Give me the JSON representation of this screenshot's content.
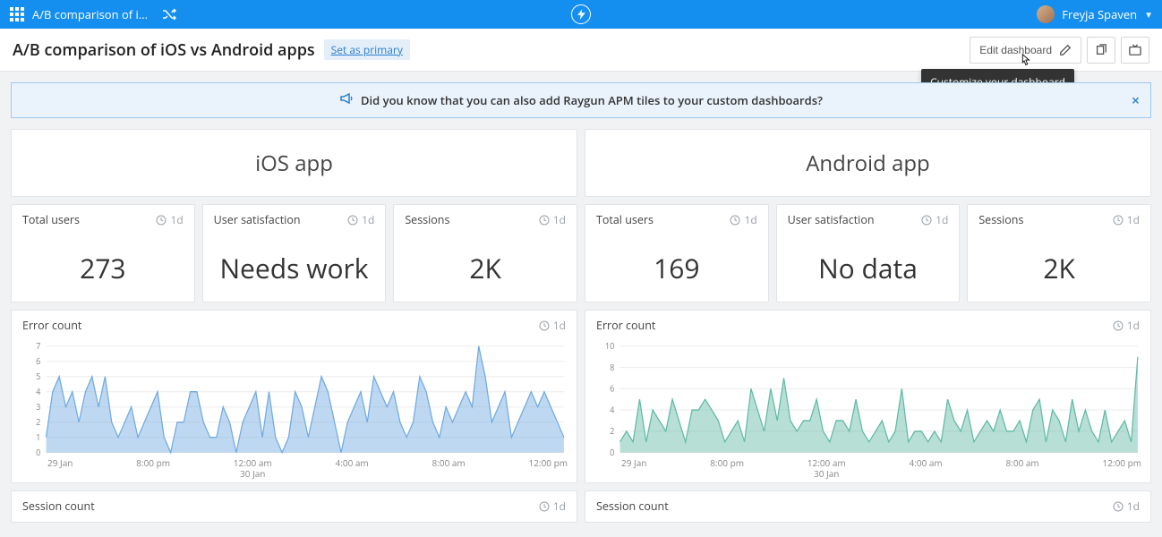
{
  "topbar": {
    "title_truncated": "A/B comparison of i…",
    "user_name": "Freyja Spaven"
  },
  "titlebar": {
    "title": "A/B comparison of iOS vs Android apps",
    "set_primary": "Set as primary",
    "edit_dashboard": "Edit dashboard",
    "tooltip": "Customize your dashboard"
  },
  "banner": {
    "text": "Did you know that you can also add Raygun APM tiles to your custom dashboards?"
  },
  "period_label": "1d",
  "ios": {
    "heading": "iOS app",
    "stats": {
      "total_users": {
        "label": "Total users",
        "value": "273"
      },
      "satisfaction": {
        "label": "User satisfaction",
        "value": "Needs work"
      },
      "sessions": {
        "label": "Sessions",
        "value": "2K"
      }
    },
    "error_label": "Error count",
    "session_label": "Session count"
  },
  "android": {
    "heading": "Android app",
    "stats": {
      "total_users": {
        "label": "Total users",
        "value": "169"
      },
      "satisfaction": {
        "label": "User satisfaction",
        "value": "No data"
      },
      "sessions": {
        "label": "Sessions",
        "value": "2K"
      }
    },
    "error_label": "Error count",
    "session_label": "Session count"
  },
  "chart_data": [
    {
      "type": "area",
      "name": "ios-error-count",
      "title": "Error count",
      "ylabel": "",
      "xlabel": "",
      "ylim": [
        0,
        7
      ],
      "y_ticks": [
        0,
        1,
        2,
        3,
        4,
        5,
        6,
        7
      ],
      "x_ticks": [
        "29 Jan",
        "8:00 pm",
        "12:00 am\n30 Jan",
        "4:00 am",
        "8:00 am",
        "12:00 pm"
      ],
      "color": "#6fa9df",
      "values": [
        1,
        4,
        5,
        3,
        4,
        2,
        4,
        5,
        3,
        5,
        2,
        1,
        2,
        3,
        1,
        2,
        3,
        4,
        1,
        0,
        2,
        2,
        4,
        4,
        2,
        1,
        1,
        3,
        2,
        0,
        2,
        3,
        4,
        1,
        4,
        1,
        0,
        1,
        4,
        3,
        1,
        3,
        5,
        4,
        2,
        0,
        2,
        3,
        4,
        2,
        5,
        4,
        3,
        4,
        2,
        1,
        2,
        5,
        4,
        2,
        1,
        3,
        2,
        3,
        4,
        3,
        7,
        5,
        2,
        3,
        4,
        1,
        2,
        3,
        4,
        3,
        4,
        3,
        2,
        1
      ]
    },
    {
      "type": "area",
      "name": "android-error-count",
      "title": "Error count",
      "ylabel": "",
      "xlabel": "",
      "ylim": [
        0,
        10
      ],
      "y_ticks": [
        0,
        2,
        4,
        6,
        8,
        10
      ],
      "x_ticks": [
        "29 Jan",
        "8:00 pm",
        "12:00 am\n30 Jan",
        "4:00 am",
        "8:00 am",
        "12:00 pm"
      ],
      "color": "#5fb9a4",
      "values": [
        1,
        2,
        1,
        5,
        1,
        4,
        3,
        2,
        5,
        3,
        1,
        4,
        4,
        5,
        4,
        3,
        1,
        2,
        3,
        1,
        6,
        4,
        2,
        6,
        3,
        7,
        3,
        2,
        3,
        3,
        5,
        2,
        1,
        3,
        3,
        2,
        5,
        2,
        1,
        2,
        3,
        1,
        2,
        6,
        1,
        2,
        2,
        1,
        2,
        1,
        5,
        3,
        2,
        4,
        1,
        2,
        3,
        2,
        4,
        2,
        2,
        3,
        1,
        4,
        5,
        1,
        4,
        3,
        1,
        5,
        2,
        4,
        2,
        1,
        4,
        1,
        2,
        3,
        1,
        9
      ]
    }
  ]
}
